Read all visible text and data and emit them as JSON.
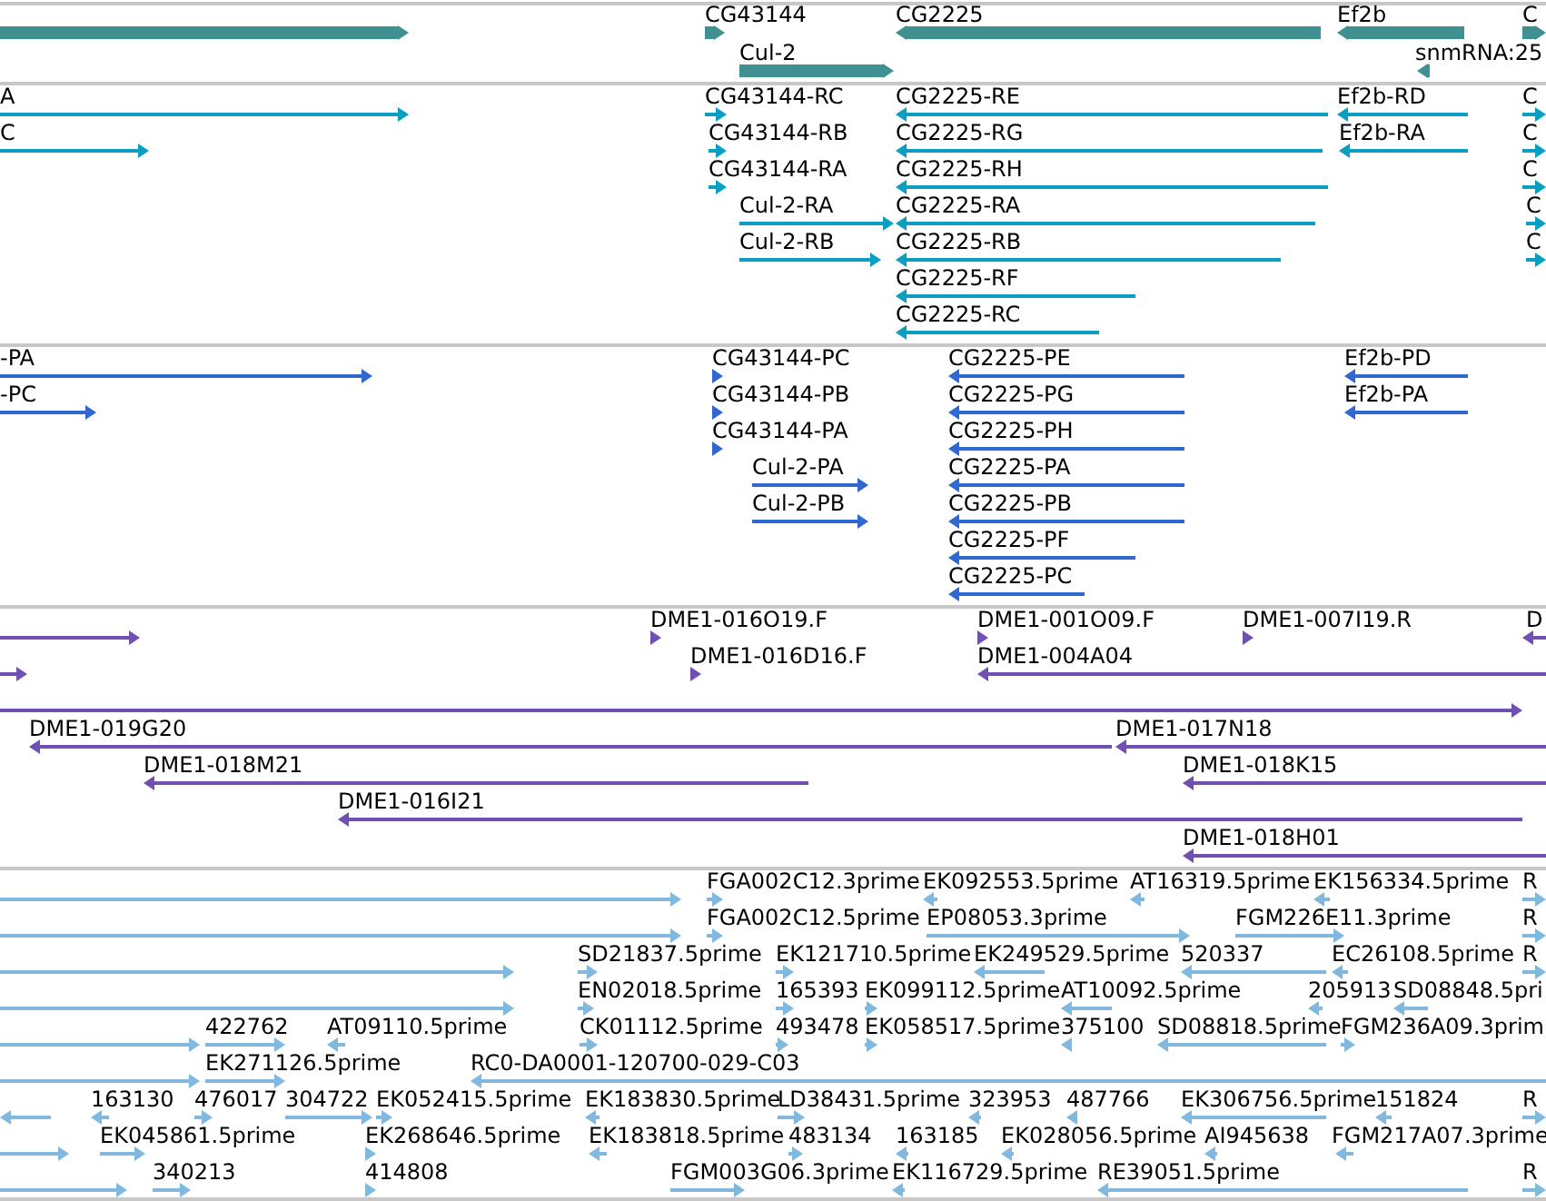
{
  "tracks": [
    {
      "kind": "gene",
      "features": [
        {
          "reverse": false
        },
        {
          "label": "CG43144",
          "reverse": false
        },
        {
          "label": "Cul-2",
          "reverse": false
        },
        {
          "label": "CG2225",
          "reverse": true
        },
        {
          "label": "Ef2b",
          "reverse": true
        },
        {
          "label": "snmRNA:25",
          "reverse": true
        },
        {
          "label": "C",
          "reverse": false
        }
      ]
    },
    {
      "kind": "transcript",
      "features": [
        {
          "label": "A",
          "reverse": false
        },
        {
          "label": "C",
          "reverse": false
        },
        {
          "label": "CG43144-RC",
          "reverse": false
        },
        {
          "label": "CG43144-RB",
          "reverse": false
        },
        {
          "label": "CG43144-RA",
          "reverse": false
        },
        {
          "label": "Cul-2-RA",
          "reverse": false
        },
        {
          "label": "Cul-2-RB",
          "reverse": false
        },
        {
          "label": "CG2225-RE",
          "reverse": true
        },
        {
          "label": "CG2225-RG",
          "reverse": true
        },
        {
          "label": "CG2225-RH",
          "reverse": true
        },
        {
          "label": "CG2225-RA",
          "reverse": true
        },
        {
          "label": "CG2225-RB",
          "reverse": true
        },
        {
          "label": "CG2225-RF",
          "reverse": true
        },
        {
          "label": "CG2225-RC",
          "reverse": true
        },
        {
          "label": "Ef2b-RD",
          "reverse": true
        },
        {
          "label": "Ef2b-RA",
          "reverse": true
        },
        {
          "label": "C",
          "reverse": false
        },
        {
          "label": "C",
          "reverse": false
        },
        {
          "label": "C",
          "reverse": false
        },
        {
          "label": "C",
          "reverse": false
        },
        {
          "label": "C",
          "reverse": false
        }
      ]
    },
    {
      "kind": "protein",
      "features": [
        {
          "label": "-PA",
          "reverse": false
        },
        {
          "label": "-PC",
          "reverse": false
        },
        {
          "label": "CG43144-PC",
          "reverse": false
        },
        {
          "label": "CG43144-PB",
          "reverse": false
        },
        {
          "label": "CG43144-PA",
          "reverse": false
        },
        {
          "label": "Cul-2-PA",
          "reverse": false
        },
        {
          "label": "Cul-2-PB",
          "reverse": false
        },
        {
          "label": "CG2225-PE",
          "reverse": true
        },
        {
          "label": "CG2225-PG",
          "reverse": true
        },
        {
          "label": "CG2225-PH",
          "reverse": true
        },
        {
          "label": "CG2225-PA",
          "reverse": true
        },
        {
          "label": "CG2225-PB",
          "reverse": true
        },
        {
          "label": "CG2225-PF",
          "reverse": true
        },
        {
          "label": "CG2225-PC",
          "reverse": true
        },
        {
          "label": "Ef2b-PD",
          "reverse": true
        },
        {
          "label": "Ef2b-PA",
          "reverse": true
        }
      ]
    },
    {
      "kind": "clone",
      "features": [
        {
          "reverse": false
        },
        {
          "label": "DME1-016O19.F",
          "reverse": false
        },
        {
          "label": "DME1-001O09.F",
          "reverse": false
        },
        {
          "label": "DME1-007I19.R",
          "reverse": false
        },
        {
          "label": "D",
          "reverse": true
        },
        {
          "reverse": false
        },
        {
          "label": "DME1-016D16.F",
          "reverse": false
        },
        {
          "label": "DME1-004A04",
          "reverse": true
        },
        {
          "reverse": false
        },
        {
          "label": "DME1-019G20",
          "reverse": true
        },
        {
          "label": "DME1-017N18",
          "reverse": true
        },
        {
          "label": "DME1-018M21",
          "reverse": true
        },
        {
          "label": "DME1-018K15",
          "reverse": true
        },
        {
          "label": "DME1-016I21",
          "reverse": true
        },
        {
          "label": "DME1-018H01",
          "reverse": true
        }
      ]
    },
    {
      "kind": "est",
      "features": [
        {
          "reverse": false
        },
        {
          "label": "FGA002C12.3prime",
          "reverse": false
        },
        {
          "label": "EK092553.5prime",
          "reverse": true
        },
        {
          "label": "AT16319.5prime",
          "reverse": true
        },
        {
          "label": "EK156334.5prime",
          "reverse": true
        },
        {
          "label": "R",
          "reverse": false
        },
        {
          "reverse": false
        },
        {
          "label": "FGA002C12.5prime",
          "reverse": false
        },
        {
          "label": "EP08053.3prime",
          "reverse": false
        },
        {
          "label": "FGM226E11.3prime",
          "reverse": false
        },
        {
          "label": "R",
          "reverse": false
        },
        {
          "reverse": false
        },
        {
          "label": "SD21837.5prime",
          "reverse": false
        },
        {
          "label": "EK121710.5prime",
          "reverse": false
        },
        {
          "label": "EK249529.5prime",
          "reverse": true
        },
        {
          "label": "520337",
          "reverse": true
        },
        {
          "label": "EC26108.5prime",
          "reverse": true
        },
        {
          "label": "R",
          "reverse": false
        },
        {
          "reverse": false
        },
        {
          "label": "EN02018.5prime",
          "reverse": false
        },
        {
          "label": "165393",
          "reverse": false
        },
        {
          "label": "EK099112.5prime",
          "reverse": false
        },
        {
          "label": "AT10092.5prime",
          "reverse": true
        },
        {
          "label": "205913",
          "reverse": true
        },
        {
          "label": "SD08848.5pri",
          "reverse": true
        },
        {
          "reverse": false
        },
        {
          "label": "422762",
          "reverse": false
        },
        {
          "label": "AT09110.5prime",
          "reverse": true
        },
        {
          "label": "CK01112.5prime",
          "reverse": false
        },
        {
          "label": "493478",
          "reverse": false
        },
        {
          "label": "EK058517.5prime",
          "reverse": false
        },
        {
          "label": "375100",
          "reverse": true
        },
        {
          "label": "SD08818.5prime",
          "reverse": true
        },
        {
          "label": "FGM236A09.3prim",
          "reverse": false
        },
        {
          "reverse": false
        },
        {
          "label": "EK271126.5prime",
          "reverse": false
        },
        {
          "label": "RC0-DA0001-120700-029-C03",
          "reverse": true
        },
        {
          "reverse": true
        },
        {
          "label": "163130",
          "reverse": true
        },
        {
          "label": "476017",
          "reverse": false
        },
        {
          "label": "304722",
          "reverse": false
        },
        {
          "label": "EK052415.5prime",
          "reverse": false
        },
        {
          "label": "EK183830.5prime",
          "reverse": true
        },
        {
          "label": "LD38431.5prime",
          "reverse": false
        },
        {
          "label": "323953",
          "reverse": true
        },
        {
          "label": "487766",
          "reverse": true
        },
        {
          "label": "EK306756.5prime",
          "reverse": true
        },
        {
          "label": "151824",
          "reverse": true
        },
        {
          "label": "R",
          "reverse": false
        },
        {
          "reverse": false
        },
        {
          "label": "EK045861.5prime",
          "reverse": false
        },
        {
          "label": "EK268646.5prime",
          "reverse": false
        },
        {
          "label": "EK183818.5prime",
          "reverse": true
        },
        {
          "label": "483134",
          "reverse": false
        },
        {
          "label": "163185",
          "reverse": true
        },
        {
          "label": "EK028056.5prime",
          "reverse": true
        },
        {
          "label": "AI945638",
          "reverse": true
        },
        {
          "label": "FGM217A07.3prime",
          "reverse": true
        },
        {
          "reverse": false
        },
        {
          "label": "340213",
          "reverse": false
        },
        {
          "label": "414808",
          "reverse": false
        },
        {
          "label": "FGM003G06.3prime",
          "reverse": false
        },
        {
          "label": "EK116729.5prime",
          "reverse": true
        },
        {
          "label": "RE39051.5prime",
          "reverse": true
        },
        {
          "label": "R",
          "reverse": false
        }
      ]
    }
  ]
}
